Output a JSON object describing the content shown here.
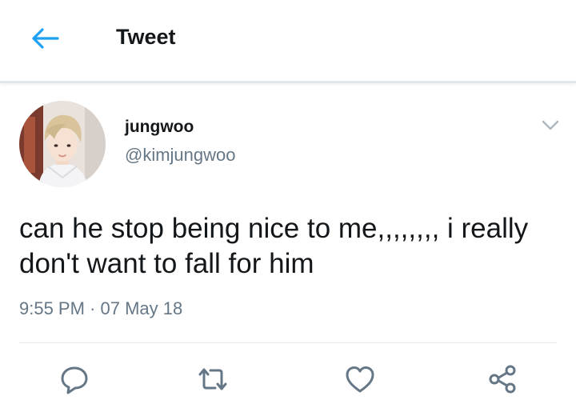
{
  "header": {
    "title": "Tweet",
    "back_icon": "arrow-left-icon"
  },
  "author": {
    "display_name": "jungwoo",
    "handle": "@kimjungwoo"
  },
  "tweet": {
    "text": "can he stop being nice to me,,,,,,,, i really\ndon't want to fall for him",
    "timestamp": "9:55 PM · 07 May 18"
  },
  "actions": [
    {
      "name": "reply",
      "icon": "reply-icon"
    },
    {
      "name": "retweet",
      "icon": "retweet-icon"
    },
    {
      "name": "like",
      "icon": "heart-icon"
    },
    {
      "name": "share",
      "icon": "share-icon"
    }
  ],
  "colors": {
    "accent": "#1da1f2",
    "text": "#14171a",
    "secondary": "#657786",
    "icon": "#657786",
    "divider": "#e6ecf0"
  }
}
